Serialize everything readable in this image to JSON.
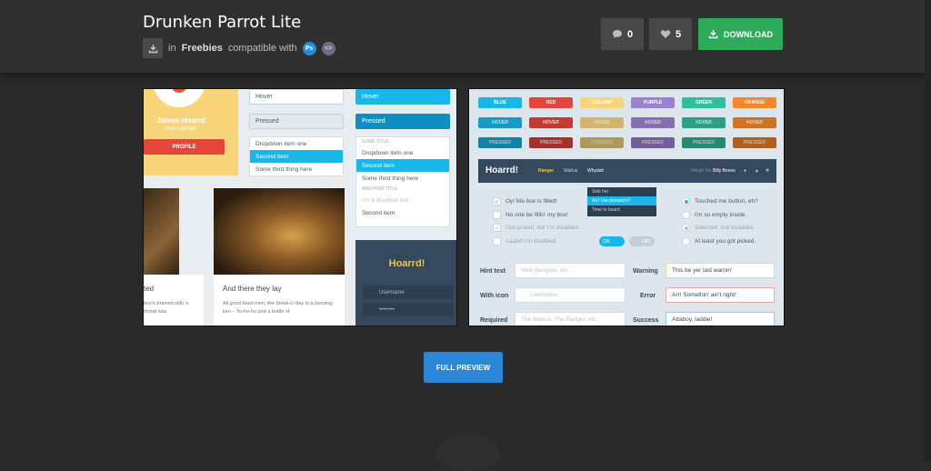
{
  "header": {
    "title": "Drunken Parrot Lite",
    "in_label": "in",
    "category": "Freebies",
    "compat_label": "compatible with",
    "compat_icons": [
      "photoshop-icon",
      "code-icon"
    ],
    "ps_text": "Ps",
    "code_text": "<>",
    "comments_count": "0",
    "likes_count": "5",
    "download_label": "DOWNLOAD"
  },
  "colors": {
    "background": "#2a2a2a",
    "topbar": "#303030",
    "download": "#2eaa5b",
    "full_preview": "#2b86d8"
  },
  "full_preview_label": "FULL PREVIEW",
  "preview_left": {
    "profile_name": "James Hoarrd",
    "profile_role": "SHIP CAPTAIN",
    "profile_button": "PROFILE",
    "select_hover": "Hover",
    "select_pressed": "Pressed",
    "select_hover_blue": "Hover",
    "select_pressed_blue": "Pressed",
    "dropdown1": [
      "Dropdown item one",
      "Second item",
      "Some third thing here"
    ],
    "dropdown2_title1": "SOME TITLE",
    "dropdown2": [
      "Dropdown item one",
      "Second item",
      "Some third thing here"
    ],
    "dropdown2_title2": "ANOTHER TITLE",
    "dropdown2_disabled": "I'm a disabled link",
    "dropdown2_last": "Second item",
    "card1_title": "ted",
    "card1_text": "bos'n brained with 's throat was",
    "card2_title": "And there they lay",
    "card2_text": "All good dead men, like break-o'-day in a boozing-ken – Yo-ho-ho and a bottle of",
    "login_title": "Hoarrd!",
    "login_user": "Username",
    "login_pass": "••••••••"
  },
  "preview_right": {
    "button_rows": [
      [
        "BLUE",
        "RED",
        "YELLOW",
        "PURPLE",
        "GREEN",
        "ORANGE"
      ],
      [
        "HOVER",
        "HOVER",
        "HOVER",
        "HOVER",
        "HOVER",
        "HOVER"
      ],
      [
        "PRESSED",
        "PRESSED",
        "PRESSED",
        "PRESSED",
        "PRESSED",
        "PRESSED"
      ]
    ],
    "button_colors": [
      "#19b6ea",
      "#e7443b",
      "#f8d57b",
      "#9b82d0",
      "#2fbf9c",
      "#f5862a"
    ],
    "nav_brand": "Hoarrd!",
    "nav_items": [
      "Ranger",
      "Walrus",
      "Whydah"
    ],
    "nav_right": "Weigh the,",
    "nav_user": "Billy Bones",
    "menu_items": [
      "Sink her",
      "Arr! I be plunderin'!",
      "Time to board"
    ],
    "checks": [
      "Oy! Me box is filled!",
      "No one be fillin' my box!",
      "Got picked, but I'm disabled.",
      "Aaand I'm disabled."
    ],
    "radios": [
      "Touched me button, eh?",
      "I'm so empty inside.",
      "Selected, but disabled.",
      "At least you got picked."
    ],
    "toggle_on": "ON",
    "toggle_off": "OFF",
    "form": {
      "hint_label": "Hint text",
      "hint_placeholder": "Web designer, etc.",
      "icon_label": "With icon",
      "icon_placeholder": "Username",
      "required_label": "Required",
      "required_placeholder": "The Walrus, The Ranger, etc.",
      "warning_label": "Warning",
      "warning_value": "This be yer last warnin'",
      "error_label": "Error",
      "error_value": "Arr! Somethin' ain't right!",
      "success_label": "Success",
      "success_value": "Attaboy, laddie!"
    }
  }
}
